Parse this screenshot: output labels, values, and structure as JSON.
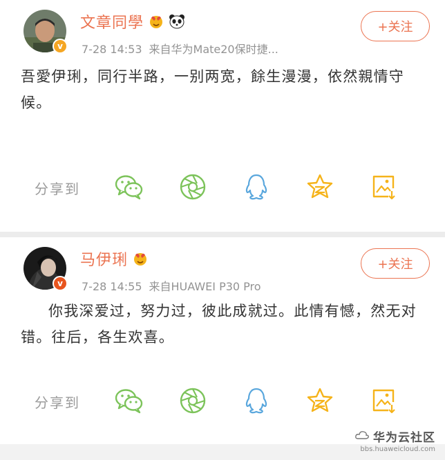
{
  "posts": [
    {
      "username": "文章同學",
      "time": "7-28 14:53",
      "source": "来自华为Mate20保时捷...",
      "follow_label": "+关注",
      "content": "吾愛伊琍，同行半路，一别两宽，餘生漫漫，依然親情守候。",
      "share_label": "分享到",
      "badges": [
        "heart-face-badge",
        "panda-badge"
      ]
    },
    {
      "username": "马伊琍",
      "time": "7-28 14:55",
      "source": "来自HUAWEI P30 Pro",
      "follow_label": "+关注",
      "content": "你我深爱过，努力过，彼此成就过。此情有憾，然无对错。往后，各生欢喜。",
      "share_label": "分享到",
      "badges": [
        "heart-face-badge"
      ]
    }
  ],
  "share_icons": [
    "wechat-icon",
    "moments-icon",
    "qq-icon",
    "qzone-icon",
    "save-image-icon"
  ],
  "colors": {
    "accent": "#eb7350",
    "icon_green": "#7cc35a",
    "icon_blue": "#5aa7dd",
    "icon_gold": "#f5b31a",
    "verified": "#f5a623"
  },
  "watermark": {
    "title": "华为云社区",
    "url": "bbs.huaweicloud.com"
  }
}
